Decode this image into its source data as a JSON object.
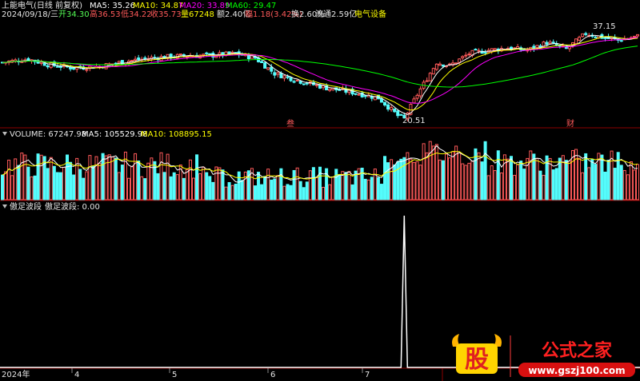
{
  "header": {
    "title": "上能电气(日线 前复权)",
    "ma5": "MA5: 35.26",
    "ma10": "MA10: 34.87",
    "ma20": "MA20: 33.89",
    "ma60": "MA60: 29.47",
    "date": "2024/09/18/三",
    "open": "开34.30",
    "high": "高36.53",
    "low": "低34.22",
    "close": "收35.73",
    "vol": "量67248",
    "amount": "额2.40亿",
    "change": "幅1.18(3.42%)",
    "turnover": "换2.60%",
    "float": "流通2.59亿",
    "sector": "电气设备"
  },
  "price_panel": {
    "high_label": "37.15",
    "low_label": "20.51",
    "marker1": "叁",
    "marker2": "财"
  },
  "volume_panel": {
    "label": "VOLUME: 67247.98",
    "ma5": "MA5: 105529.98",
    "ma10": "MA10: 108895.15"
  },
  "indicator_panel": {
    "label": "傲足波段",
    "value": "傲足波段: 0.00"
  },
  "axis": {
    "labels": [
      "2024年",
      "4",
      "5",
      "6",
      "7"
    ]
  },
  "watermark": {
    "logo_char": "股",
    "brand": "公式之家",
    "url": "www.gszj100.com"
  },
  "colors": {
    "up": "#ff5a5a",
    "down": "#54fcfc",
    "ma5": "#ffffff",
    "ma10": "#ffff00",
    "ma20": "#ff00ff",
    "ma60": "#00ff00",
    "panel_border": "#8b0000"
  },
  "chart_data": [
    {
      "type": "candlestick",
      "title": "上能电气(日线 前复权)",
      "ylim": [
        19.5,
        38.5
      ],
      "key_points": [
        {
          "label": "low",
          "value": 20.51
        },
        {
          "label": "high",
          "value": 37.15
        }
      ],
      "last": {
        "open": 34.3,
        "high": 36.53,
        "low": 34.22,
        "close": 35.73
      },
      "moving_averages": {
        "MA5": 35.26,
        "MA10": 34.87,
        "MA20": 33.89,
        "MA60": 29.47
      }
    },
    {
      "type": "bar",
      "title": "VOLUME",
      "last_value": 67247.98,
      "MA5": 105529.98,
      "MA10": 108895.15
    },
    {
      "type": "line",
      "title": "傲足波段",
      "last_value": 0.0,
      "peak_value": 1
    }
  ]
}
